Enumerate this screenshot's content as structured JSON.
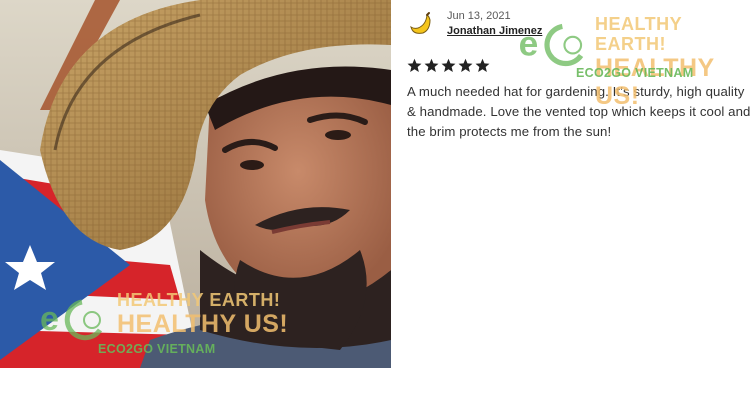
{
  "review": {
    "date": "Jun 13, 2021",
    "author": "Jonathan Jimenez",
    "rating": 5,
    "rating_max": 5,
    "avatar_icon": "banana-icon",
    "text": "A much needed hat for gardening. It’s sturdy, high quality & handmade. Love the vented top which keeps it cool and the brim protects me from the sun!"
  },
  "watermark": {
    "slogan_line1": "HEALTHY EARTH!",
    "slogan_line2": "HEALTHY US!",
    "brand": "ECO2GO VIETNAM",
    "logo_text": "eco"
  },
  "colors": {
    "star": "#222222",
    "watermark_orange": "#f2c876",
    "watermark_green": "#68b85a"
  }
}
